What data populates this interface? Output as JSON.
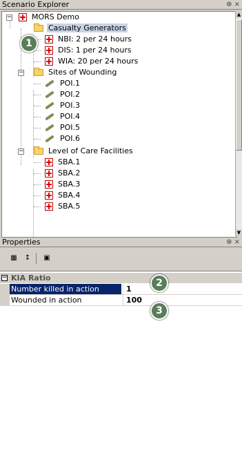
{
  "explorer": {
    "title": "Scenario Explorer",
    "pin": "⊕ ×"
  },
  "tree": {
    "root": "MORS Demo",
    "casualty_generators": "Casualty Generators",
    "nbi": "NBI: 2 per 24 hours",
    "dis": "DIS: 1 per 24 hours",
    "wia": "WIA: 20 per 24 hours",
    "sites_of_wounding": "Sites of Wounding",
    "poi": [
      "POI.1",
      "POI.2",
      "POI.3",
      "POI.4",
      "POI.5",
      "POI.6"
    ],
    "level_of_care": "Level of Care Facilities",
    "sba": [
      "SBA.1",
      "SBA.2",
      "SBA.3",
      "SBA.4",
      "SBA.5"
    ]
  },
  "properties": {
    "title": "Properties",
    "pin": "⊕ ×",
    "category": "KIA Ratio",
    "rows": [
      {
        "name": "Number killed in action",
        "value": "1"
      },
      {
        "name": "Wounded in action",
        "value": "100"
      }
    ]
  },
  "callouts": [
    "1",
    "2",
    "3"
  ],
  "colors": {
    "callout": "#5a7d5a",
    "selection": "#0a246a",
    "chrome": "#d4d0c8"
  }
}
